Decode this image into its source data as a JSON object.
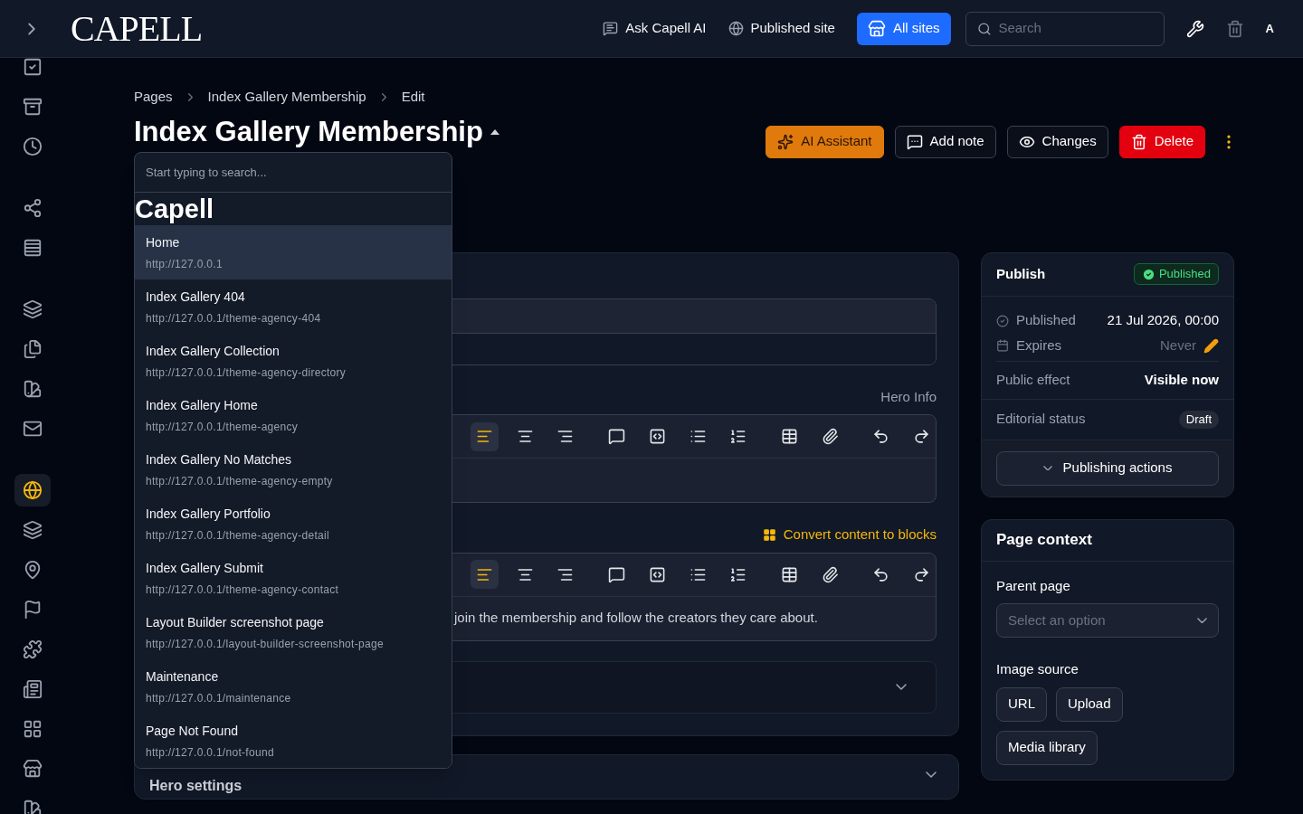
{
  "topbar": {
    "logo": "CAPELL",
    "links": [
      {
        "label": "Ask Capell AI"
      },
      {
        "label": "Published site"
      }
    ],
    "sites_button": "All sites",
    "search": {
      "placeholder": "Search"
    },
    "avatar": "A"
  },
  "sidebar": {
    "items": [
      {
        "selected": false
      },
      {
        "selected": false
      },
      {
        "selected": false
      },
      {
        "selected": false
      },
      {
        "selected": false
      },
      {
        "selected": false
      },
      {
        "selected": false
      },
      {
        "selected": false
      },
      {
        "selected": false
      },
      {
        "selected": true
      },
      {
        "selected": false
      },
      {
        "selected": false
      },
      {
        "selected": false
      },
      {
        "selected": false
      },
      {
        "selected": false
      },
      {
        "selected": false
      },
      {
        "selected": false
      },
      {
        "selected": false
      }
    ]
  },
  "breadcrumbs": [
    "Pages",
    "Index Gallery Membership",
    "Edit"
  ],
  "title": "Index Gallery Membership",
  "actions": [
    {
      "kind": "ai",
      "label": "AI Assistant"
    },
    {
      "kind": "note",
      "label": "Add note"
    },
    {
      "kind": "changes",
      "label": "Changes"
    },
    {
      "kind": "delete",
      "label": "Delete"
    }
  ],
  "page_picker": {
    "placeholder": "Start typing to search...",
    "group": "Capell",
    "options": [
      {
        "title": "Home",
        "url": "http://127.0.0.1",
        "selected": true
      },
      {
        "title": "Index Gallery 404",
        "url": "http://127.0.0.1/theme-agency-404",
        "selected": false
      },
      {
        "title": "Index Gallery Collection",
        "url": "http://127.0.0.1/theme-agency-directory",
        "selected": false
      },
      {
        "title": "Index Gallery Home",
        "url": "http://127.0.0.1/theme-agency",
        "selected": false
      },
      {
        "title": "Index Gallery No Matches",
        "url": "http://127.0.0.1/theme-agency-empty",
        "selected": false
      },
      {
        "title": "Index Gallery Portfolio",
        "url": "http://127.0.0.1/theme-agency-detail",
        "selected": false
      },
      {
        "title": "Index Gallery Submit",
        "url": "http://127.0.0.1/theme-agency-contact",
        "selected": false
      },
      {
        "title": "Layout Builder screenshot page",
        "url": "http://127.0.0.1/layout-builder-screenshot-page",
        "selected": false
      },
      {
        "title": "Maintenance",
        "url": "http://127.0.0.1/maintenance",
        "selected": false
      },
      {
        "title": "Page Not Found",
        "url": "http://127.0.0.1/not-found",
        "selected": false
      }
    ]
  },
  "editor": {
    "hero_info_label": "Hero Info",
    "toolbar": [
      {
        "selected": true
      },
      {
        "selected": false
      },
      {
        "selected": false
      },
      {
        "selected": false
      },
      {
        "selected": false
      },
      {
        "selected": false
      },
      {
        "selected": false
      },
      {
        "selected": false
      },
      {
        "selected": false
      },
      {
        "selected": false
      },
      {
        "selected": false
      }
    ],
    "convert_link": "Convert content to blocks",
    "body_text": "join the membership and follow the creators they care about.",
    "hero_settings": "Hero settings"
  },
  "publish": {
    "title": "Publish",
    "status": "Published",
    "published_label": "Published",
    "published_value": "21 Jul 2026, 00:00",
    "expires_label": "Expires",
    "expires_value": "Never",
    "effect_label": "Public effect",
    "effect_value": "Visible now",
    "editorial_label": "Editorial status",
    "editorial_value": "Draft",
    "actions_button": "Publishing actions"
  },
  "page_context": {
    "title": "Page context",
    "parent_label": "Parent page",
    "parent_placeholder": "Select an option",
    "image_label": "Image source",
    "image_buttons": [
      "URL",
      "Upload",
      "Media library"
    ]
  }
}
